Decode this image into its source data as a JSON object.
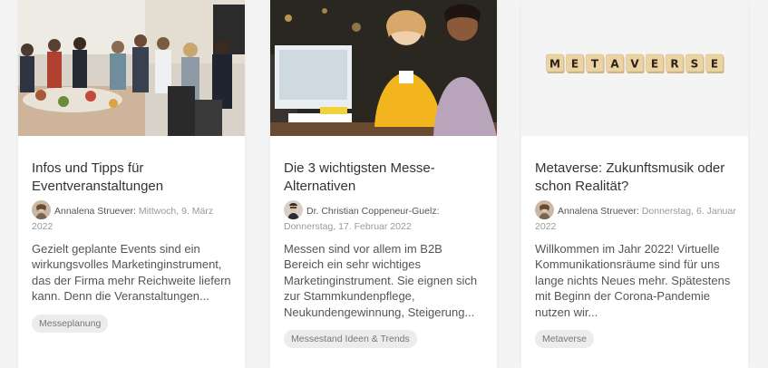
{
  "cards": [
    {
      "title": "Infos und Tipps für Eventveranstaltungen",
      "author": "Annalena Struever:",
      "date": "Mittwoch, 9. März 2022",
      "excerpt": "Gezielt geplante Events sind ein wirkungsvolles Marketinginstrument, das der Firma mehr Reichweite liefern kann. Denn die Veranstaltungen...",
      "tags": [
        "Messeplanung"
      ]
    },
    {
      "title": "Die 3 wichtigsten Messe-Alternativen",
      "author": "Dr. Christian Coppeneur-Guelz:",
      "date": "Donnerstag, 17. Februar 2022",
      "excerpt": "Messen sind vor allem im B2B Bereich ein sehr wichtiges Marketinginstrument. Sie eignen sich zur Stammkundenpflege, Neukundengewinnung, Steigerung...",
      "tags": [
        "Messestand Ideen & Trends"
      ]
    },
    {
      "title": "Metaverse: Zukunftsmusik oder schon Realität?",
      "author": "Annalena Struever:",
      "date": "Donnerstag, 6. Januar 2022",
      "excerpt": "Willkommen im Jahr 2022! Virtuelle Kommunikationsräume sind für uns lange nichts Neues mehr. Spätestens mit Beginn der Corona-Pandemie nutzen wir...",
      "tags": [
        "Metaverse"
      ],
      "image_tiles": [
        "M",
        "E",
        "T",
        "A",
        "V",
        "E",
        "R",
        "S",
        "E"
      ]
    }
  ]
}
